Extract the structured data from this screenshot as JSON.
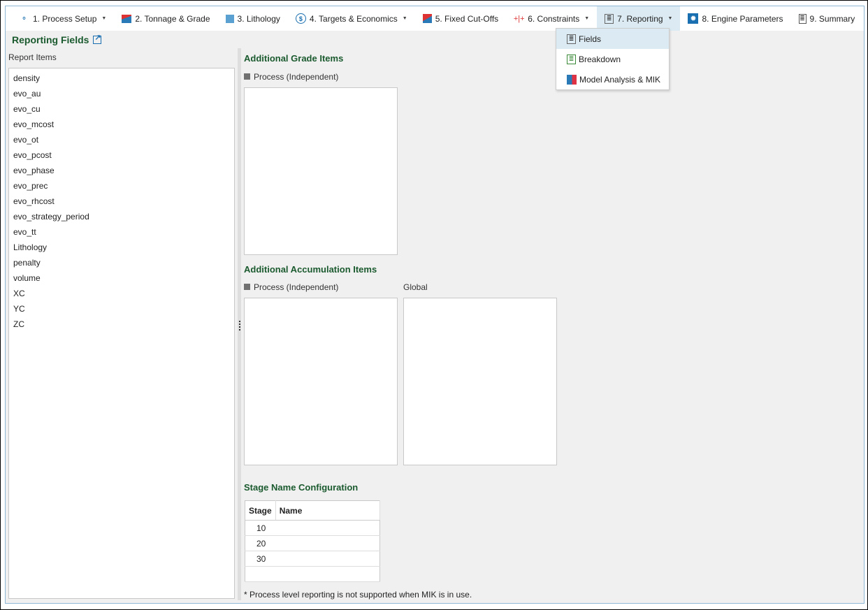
{
  "toolbar": {
    "items": [
      {
        "label": "1. Process Setup",
        "icon": "process-setup-icon",
        "dropdown": true
      },
      {
        "label": "2. Tonnage & Grade",
        "icon": "chart-area-icon",
        "dropdown": false
      },
      {
        "label": "3. Lithology",
        "icon": "lithology-icon",
        "dropdown": false
      },
      {
        "label": "4. Targets & Economics",
        "icon": "dollar-icon",
        "dropdown": true
      },
      {
        "label": "5. Fixed Cut-Offs",
        "icon": "cutoff-icon",
        "dropdown": false
      },
      {
        "label": "6. Constraints",
        "icon": "constraints-icon",
        "dropdown": true
      },
      {
        "label": "7. Reporting",
        "icon": "reporting-icon",
        "dropdown": true,
        "active": true
      },
      {
        "label": "8. Engine Parameters",
        "icon": "gear-icon",
        "dropdown": false
      },
      {
        "label": "9. Summary",
        "icon": "summary-icon",
        "dropdown": false
      }
    ]
  },
  "menu": {
    "items": [
      "Fields",
      "Breakdown",
      "Model Analysis & MIK"
    ]
  },
  "page": {
    "title": "Reporting Fields"
  },
  "left": {
    "label": "Report Items",
    "items": [
      "density",
      "evo_au",
      "evo_cu",
      "evo_mcost",
      "evo_ot",
      "evo_pcost",
      "evo_phase",
      "evo_prec",
      "evo_rhcost",
      "evo_strategy_period",
      "evo_tt",
      "Lithology",
      "penalty",
      "volume",
      "XC",
      "YC",
      "ZC"
    ]
  },
  "grade": {
    "heading": "Additional Grade Items",
    "process_label": "Process (Independent)"
  },
  "accum": {
    "heading": "Additional Accumulation Items",
    "process_label": "Process (Independent)",
    "global_label": "Global"
  },
  "stage": {
    "heading": "Stage Name Configuration",
    "columns": [
      "Stage",
      "Name"
    ],
    "rows": [
      [
        "10",
        ""
      ],
      [
        "20",
        ""
      ],
      [
        "30",
        ""
      ]
    ]
  },
  "note": "* Process level reporting is not supported when MIK is in use."
}
